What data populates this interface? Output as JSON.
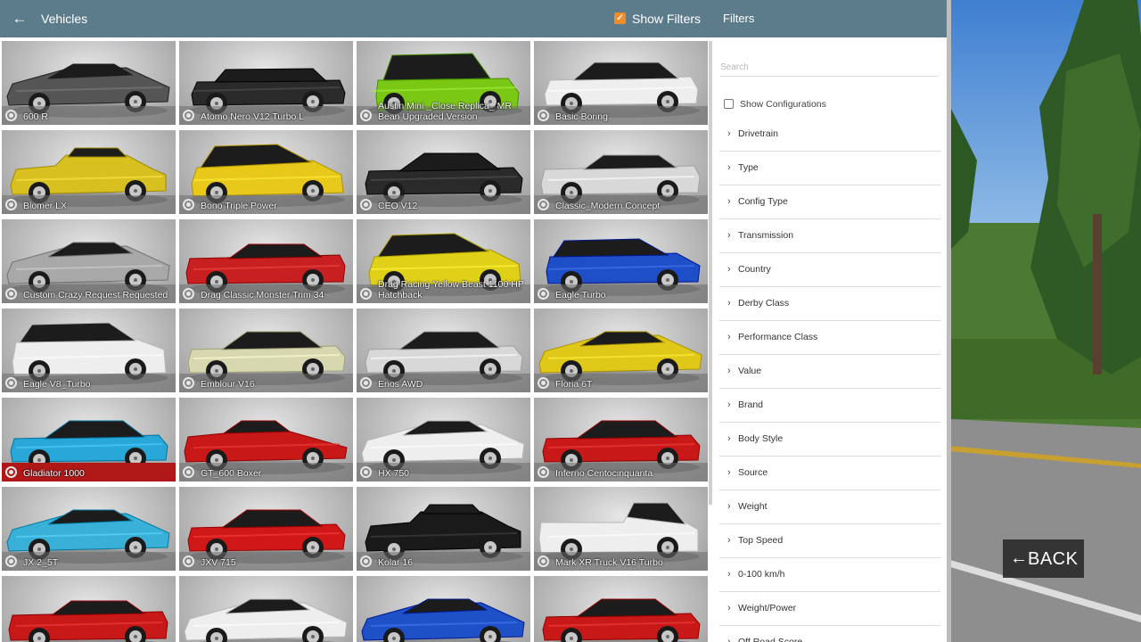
{
  "header": {
    "title": "Vehicles",
    "back_icon": "arrow-left-icon",
    "show_filters_label": "Show Filters",
    "show_filters_checked": true
  },
  "vehicles": [
    {
      "name": "600 R",
      "color": "#555555",
      "shape": "supercar"
    },
    {
      "name": "Atomo Nero V12 Turbo L",
      "color": "#2a2a2a",
      "shape": "limo"
    },
    {
      "name": "Austin Mini _Close Replica_ MR Bean Upgraded Version",
      "color": "#7ac814",
      "shape": "mini"
    },
    {
      "name": "Basic Boring",
      "color": "#eeeeee",
      "shape": "sedan"
    },
    {
      "name": "Blomer LX",
      "color": "#d8c020",
      "shape": "classic"
    },
    {
      "name": "Bono Triple Power",
      "color": "#e8c818",
      "shape": "hatch"
    },
    {
      "name": "CEO V12",
      "color": "#2a2a2a",
      "shape": "coupe"
    },
    {
      "name": "Classic_Modern Concept",
      "color": "#d8d8d8",
      "shape": "muscle"
    },
    {
      "name": "Custom Crazy Request Requested",
      "color": "#a8a8a8",
      "shape": "supercar"
    },
    {
      "name": "Drag Classic Monster Trim 34",
      "color": "#c82020",
      "shape": "muscle"
    },
    {
      "name": "Drag Racing Yellow Beast 1100 HP Hatchback",
      "color": "#e0d018",
      "shape": "hatch"
    },
    {
      "name": "Eagle Turbo",
      "color": "#1e4ec8",
      "shape": "wagon"
    },
    {
      "name": "Eagle V8_Turbo",
      "color": "#eeeeee",
      "shape": "suv"
    },
    {
      "name": "Emblour V16",
      "color": "#d8d8b0",
      "shape": "coupe"
    },
    {
      "name": "Enos AWD",
      "color": "#d8d8d8",
      "shape": "coupe"
    },
    {
      "name": "Floria 6T",
      "color": "#e0c818",
      "shape": "supercar"
    },
    {
      "name": "Gladiator 1000",
      "color": "#28a8d8",
      "shape": "coupe"
    },
    {
      "name": "GT_600 Boxer",
      "color": "#c81818",
      "shape": "racer"
    },
    {
      "name": "HX 750",
      "color": "#eeeeee",
      "shape": "supercar"
    },
    {
      "name": "Inferno Centocinquanta",
      "color": "#c81818",
      "shape": "coupe"
    },
    {
      "name": "JX 2_5T",
      "color": "#38b0d8",
      "shape": "supercar"
    },
    {
      "name": "JXV 715",
      "color": "#d01818",
      "shape": "coupe"
    },
    {
      "name": "Kolar 16",
      "color": "#1a1a1a",
      "shape": "classic"
    },
    {
      "name": "Mark XR Truck V16 Turbo",
      "color": "#eeeeee",
      "shape": "truck"
    },
    {
      "name": "",
      "color": "#c81818",
      "shape": "muscle"
    },
    {
      "name": "",
      "color": "#eeeeee",
      "shape": "supercar"
    },
    {
      "name": "",
      "color": "#1e50c8",
      "shape": "supercar"
    },
    {
      "name": "",
      "color": "#c81818",
      "shape": "coupe"
    }
  ],
  "selected_vehicle": "Gladiator 1000",
  "filters": {
    "title": "Filters",
    "search_placeholder": "Search",
    "search_value": "",
    "show_configurations_label": "Show Configurations",
    "show_configurations_checked": false,
    "items": [
      "Drivetrain",
      "Type",
      "Config Type",
      "Transmission",
      "Country",
      "Derby Class",
      "Performance Class",
      "Value",
      "Brand",
      "Body Style",
      "Source",
      "Weight",
      "Top Speed",
      "0-100 km/h",
      "Weight/Power",
      "Off Road Score"
    ]
  },
  "back_button": {
    "arrow": "←",
    "label": "BACK"
  },
  "colors": {
    "header_bg": "#5c7c8c",
    "accent_orange": "#f08c2a",
    "selected_red": "#b01818"
  }
}
